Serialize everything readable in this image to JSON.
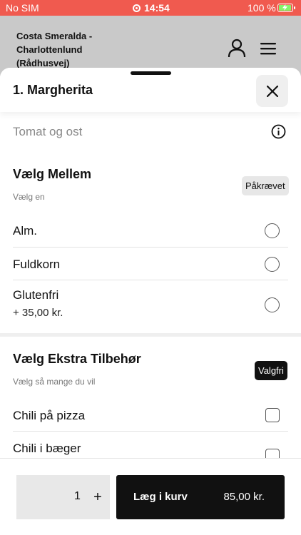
{
  "status_bar": {
    "carrier": "No SIM",
    "time": "14:54",
    "battery": "100 %",
    "battery_level": 1.0
  },
  "store": {
    "name": "Costa Smeralda - Charlottenlund (Rådhusvej)"
  },
  "product": {
    "title": "1. Margherita",
    "description": "Tomat og ost"
  },
  "groups": [
    {
      "title": "Vælg Mellem",
      "subtitle": "Vælg en",
      "badge": "Påkrævet",
      "options": [
        {
          "label": "Alm.",
          "price": "",
          "selected": false
        },
        {
          "label": "Fuldkorn",
          "price": "",
          "selected": false
        },
        {
          "label": "Glutenfri",
          "price": "+ 35,00 kr.",
          "selected": false
        }
      ]
    },
    {
      "title": "Vælg Ekstra Tilbehør",
      "subtitle": "Vælg så mange du vil",
      "badge": "Valgfri",
      "options": [
        {
          "label": "Chili på pizza",
          "checked": false
        },
        {
          "label": "Chili i bæger",
          "checked": false
        }
      ]
    }
  ],
  "footer": {
    "quantity": "1",
    "plus": "+",
    "add_label": "Læg i kurv",
    "price": "85,00 kr."
  },
  "colors": {
    "status_bar": "#f05a4f",
    "header_bg": "#c9c9c9",
    "primary": "#111111",
    "battery_fill": "#86f26a"
  }
}
